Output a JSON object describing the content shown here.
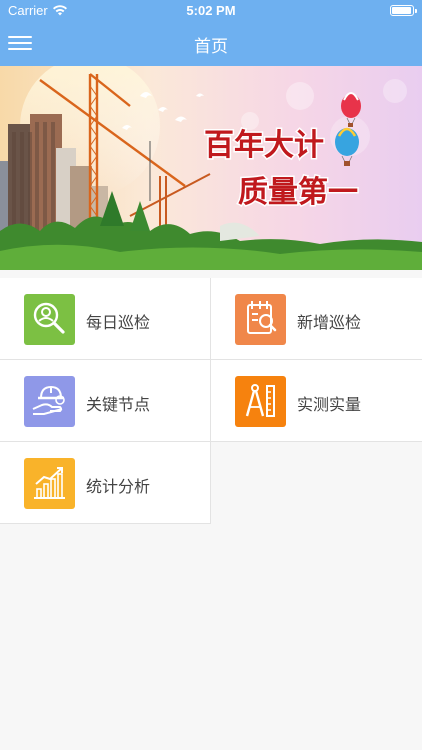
{
  "status_bar": {
    "carrier": "Carrier",
    "time": "5:02 PM",
    "battery_level": 0.95
  },
  "nav": {
    "title": "首页",
    "menu_icon": "hamburger-menu-icon"
  },
  "banner": {
    "line1": "百年大计",
    "line2": "质量第一"
  },
  "menu": {
    "items": [
      {
        "label": "每日巡检",
        "icon": "magnifier-person-icon",
        "color": "#7cc043"
      },
      {
        "label": "新增巡检",
        "icon": "checklist-icon",
        "color": "#f0874a"
      },
      {
        "label": "关键节点",
        "icon": "helmet-hand-icon",
        "color": "#8f98e8"
      },
      {
        "label": "实测实量",
        "icon": "compass-ruler-icon",
        "color": "#f6820e"
      },
      {
        "label": "统计分析",
        "icon": "bar-chart-icon",
        "color": "#f9b32a"
      }
    ]
  },
  "colors": {
    "nav_bar": "#6eb0f0",
    "banner_text": "#c0191d",
    "background": "#f7f7f7"
  }
}
